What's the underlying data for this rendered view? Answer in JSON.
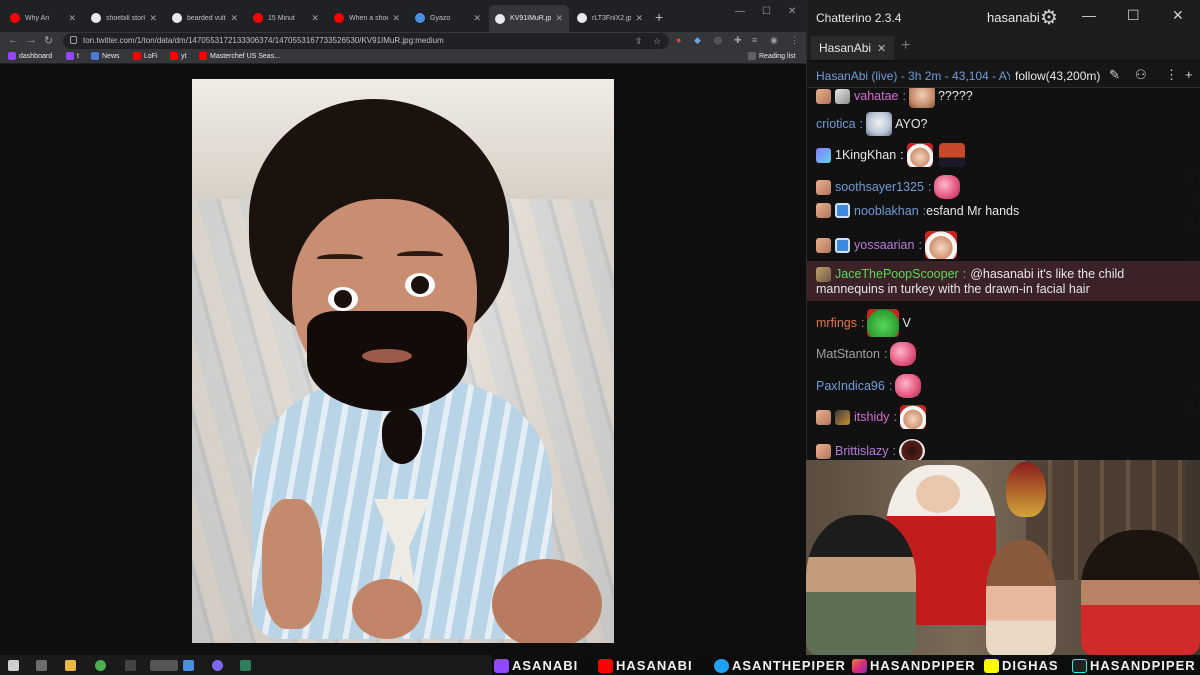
{
  "browser": {
    "tabs": [
      {
        "label": "Why Ari",
        "icon": "youtube-icon"
      },
      {
        "label": "shoebill stork",
        "icon": "google-icon"
      },
      {
        "label": "bearded vultu",
        "icon": "google-icon"
      },
      {
        "label": "15 Minut",
        "icon": "youtube-icon"
      },
      {
        "label": "When a shoe",
        "icon": "youtube-icon"
      },
      {
        "label": "Gyazo",
        "icon": "gyazo-icon"
      },
      {
        "label": "KV91IMuR.jpg",
        "icon": "globe-icon",
        "active": true
      },
      {
        "label": "rLT3FnlX2.jpg",
        "icon": "globe-icon"
      }
    ],
    "url": "ton.twitter.com/1/ton/data/dm/1470553172133306374/1470553167733526530/KV91IMuR.jpg:medium",
    "bookmarks": [
      {
        "label": "dashboard",
        "icon": "twitch-icon"
      },
      {
        "label": "t",
        "icon": "twitch-icon"
      },
      {
        "label": "News",
        "icon": "news-icon"
      },
      {
        "label": "LoFi",
        "icon": "youtube-icon"
      },
      {
        "label": "yt",
        "icon": "youtube-icon"
      },
      {
        "label": "Masterchef US Seas...",
        "icon": "youtube-icon"
      }
    ],
    "reading_list": "Reading list"
  },
  "chatterino": {
    "app_name": "Chatterino 2.3.4",
    "user": "hasanabi",
    "tab_label": "HasanAbi",
    "live_info": "HasanAbi (live) - 3h 2m - 43,104 - AY",
    "follow_info": "follow(43,200m)",
    "messages": [
      {
        "user": "vahatae",
        "color": "#d36fd0",
        "text": "?????",
        "emotes": [
          "face"
        ]
      },
      {
        "user": "criotica",
        "color": "#6f9bd8",
        "text": "AYO?",
        "emotes": [
          "guy"
        ]
      },
      {
        "user": "1KingKhan",
        "color": "#e6e6e6",
        "text": "",
        "emotes": [
          "santa",
          "haram"
        ]
      },
      {
        "user": "soothsayer1325",
        "color": "#6f9bd8",
        "text": "",
        "emotes": [
          "gem"
        ]
      },
      {
        "user": "nooblakhan",
        "color": "#6f9bd8",
        "text": "esfand Mr hands",
        "emotes": []
      },
      {
        "user": "yossaarian",
        "color": "#b77bd9",
        "text": "",
        "emotes": [
          "santa"
        ]
      },
      {
        "user": "JaceThePoopScooper",
        "color": "#58d85a",
        "text": "@hasanabi it's like the child",
        "text2": "mannequins in turkey with the drawn-in facial hair",
        "emotes": [],
        "highlight": true
      },
      {
        "user": "mrfings",
        "color": "#e0774a",
        "text": "V",
        "emotes": [
          "frog"
        ]
      },
      {
        "user": "MatStanton",
        "color": "#a0a0a0",
        "text": "",
        "emotes": [
          "gem"
        ]
      },
      {
        "user": "PaxIndica96",
        "color": "#6f9bd8",
        "text": "",
        "emotes": [
          "gem"
        ]
      },
      {
        "user": "itshidy",
        "color": "#d36fd0",
        "text": "",
        "emotes": [
          "santa"
        ]
      },
      {
        "user": "Brittislazy",
        "color": "#b77bd9",
        "text": "",
        "emotes": [
          "cup"
        ]
      }
    ]
  },
  "social_bar": {
    "items": [
      {
        "label": "ASANABI",
        "icon": "twitch-icon"
      },
      {
        "label": "HASANABI",
        "icon": "youtube-icon"
      },
      {
        "label": "ASANTHEPIPER",
        "icon": "twitter-icon"
      },
      {
        "label": "HASANDPIPER",
        "icon": "instagram-icon"
      },
      {
        "label": "DIGHAS",
        "icon": "snapchat-icon"
      },
      {
        "label": "HASANDPIPER",
        "icon": "tiktok-icon"
      }
    ]
  },
  "colors": {
    "chrome_dark": "#202124",
    "chat_bg": "#111111",
    "highlight_bg": "#3b2226",
    "live_blue": "#6f9bd8"
  }
}
